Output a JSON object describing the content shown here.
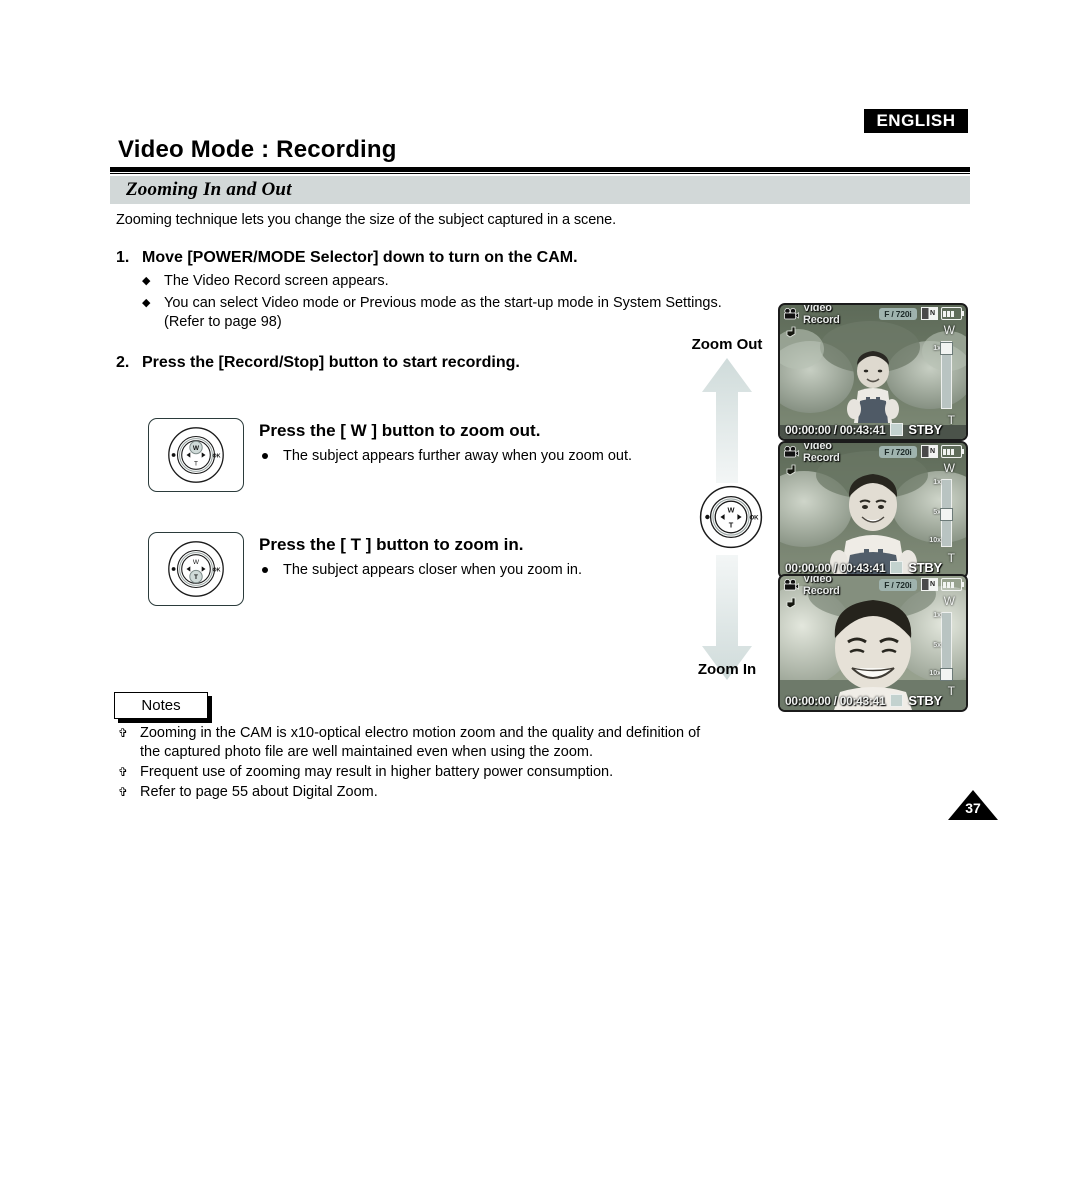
{
  "header": {
    "language_badge": "ENGLISH",
    "page_title": "Video Mode : Recording",
    "section_title": "Zooming In and Out"
  },
  "intro": "Zooming technique lets you change the size of the subject captured in a scene.",
  "steps": [
    {
      "number": "1.",
      "text": "Move [POWER/MODE Selector] down to turn on the CAM.",
      "bullets": [
        "The Video Record screen appears.",
        "You can select Video mode or Previous mode as the start-up mode in System Settings. (Refer to page 98)"
      ]
    },
    {
      "number": "2.",
      "text": "Press the [Record/Stop] button to start recording."
    }
  ],
  "zoom_blocks": [
    {
      "heading": "Press the [ W ] button to zoom out.",
      "detail": "The subject appears further away when you zoom out.",
      "active_key": "W"
    },
    {
      "heading": "Press the [ T ] button to zoom in.",
      "detail": "The subject appears closer when you zoom in.",
      "active_key": "T"
    }
  ],
  "zoom_column": {
    "top_label": "Zoom Out",
    "bottom_label": "Zoom In",
    "dial_keys": {
      "up": "W",
      "down": "T",
      "ok": "OK"
    }
  },
  "lcd_screens": [
    {
      "mode_label": "Video Record",
      "format_badge": "F / 720i",
      "card_letter": "N",
      "timecode": "00:00:00 / 00:43:41",
      "status": "STBY",
      "zoom_top": "W",
      "zoom_bottom": "T",
      "zoom_ticks": [
        "1x"
      ],
      "zoom_position": "wide"
    },
    {
      "mode_label": "Video Record",
      "format_badge": "F / 720i",
      "card_letter": "N",
      "timecode": "00:00:00 / 00:43:41",
      "status": "STBY",
      "zoom_top": "W",
      "zoom_bottom": "T",
      "zoom_ticks": [
        "1x",
        "5x",
        "10x"
      ],
      "zoom_position": "middle"
    },
    {
      "mode_label": "Video Record",
      "format_badge": "F / 720i",
      "card_letter": "N",
      "timecode": "00:00:00 / 00:43:41",
      "status": "STBY",
      "zoom_top": "W",
      "zoom_bottom": "T",
      "zoom_ticks": [
        "1x",
        "5x",
        "10x"
      ],
      "zoom_position": "tele"
    }
  ],
  "notes": {
    "label": "Notes",
    "items": [
      "Zooming in the CAM is x10-optical electro motion zoom and the quality and definition of the captured photo file are well maintained even when using the zoom.",
      "Frequent use of zooming may result in higher battery power consumption.",
      "Refer to page 55 about Digital Zoom."
    ]
  },
  "page_number": "37",
  "colors": {
    "section_bar": "#d2d8d8",
    "badge_bg": "#000000",
    "arrow_fill": "#dde4e3"
  }
}
